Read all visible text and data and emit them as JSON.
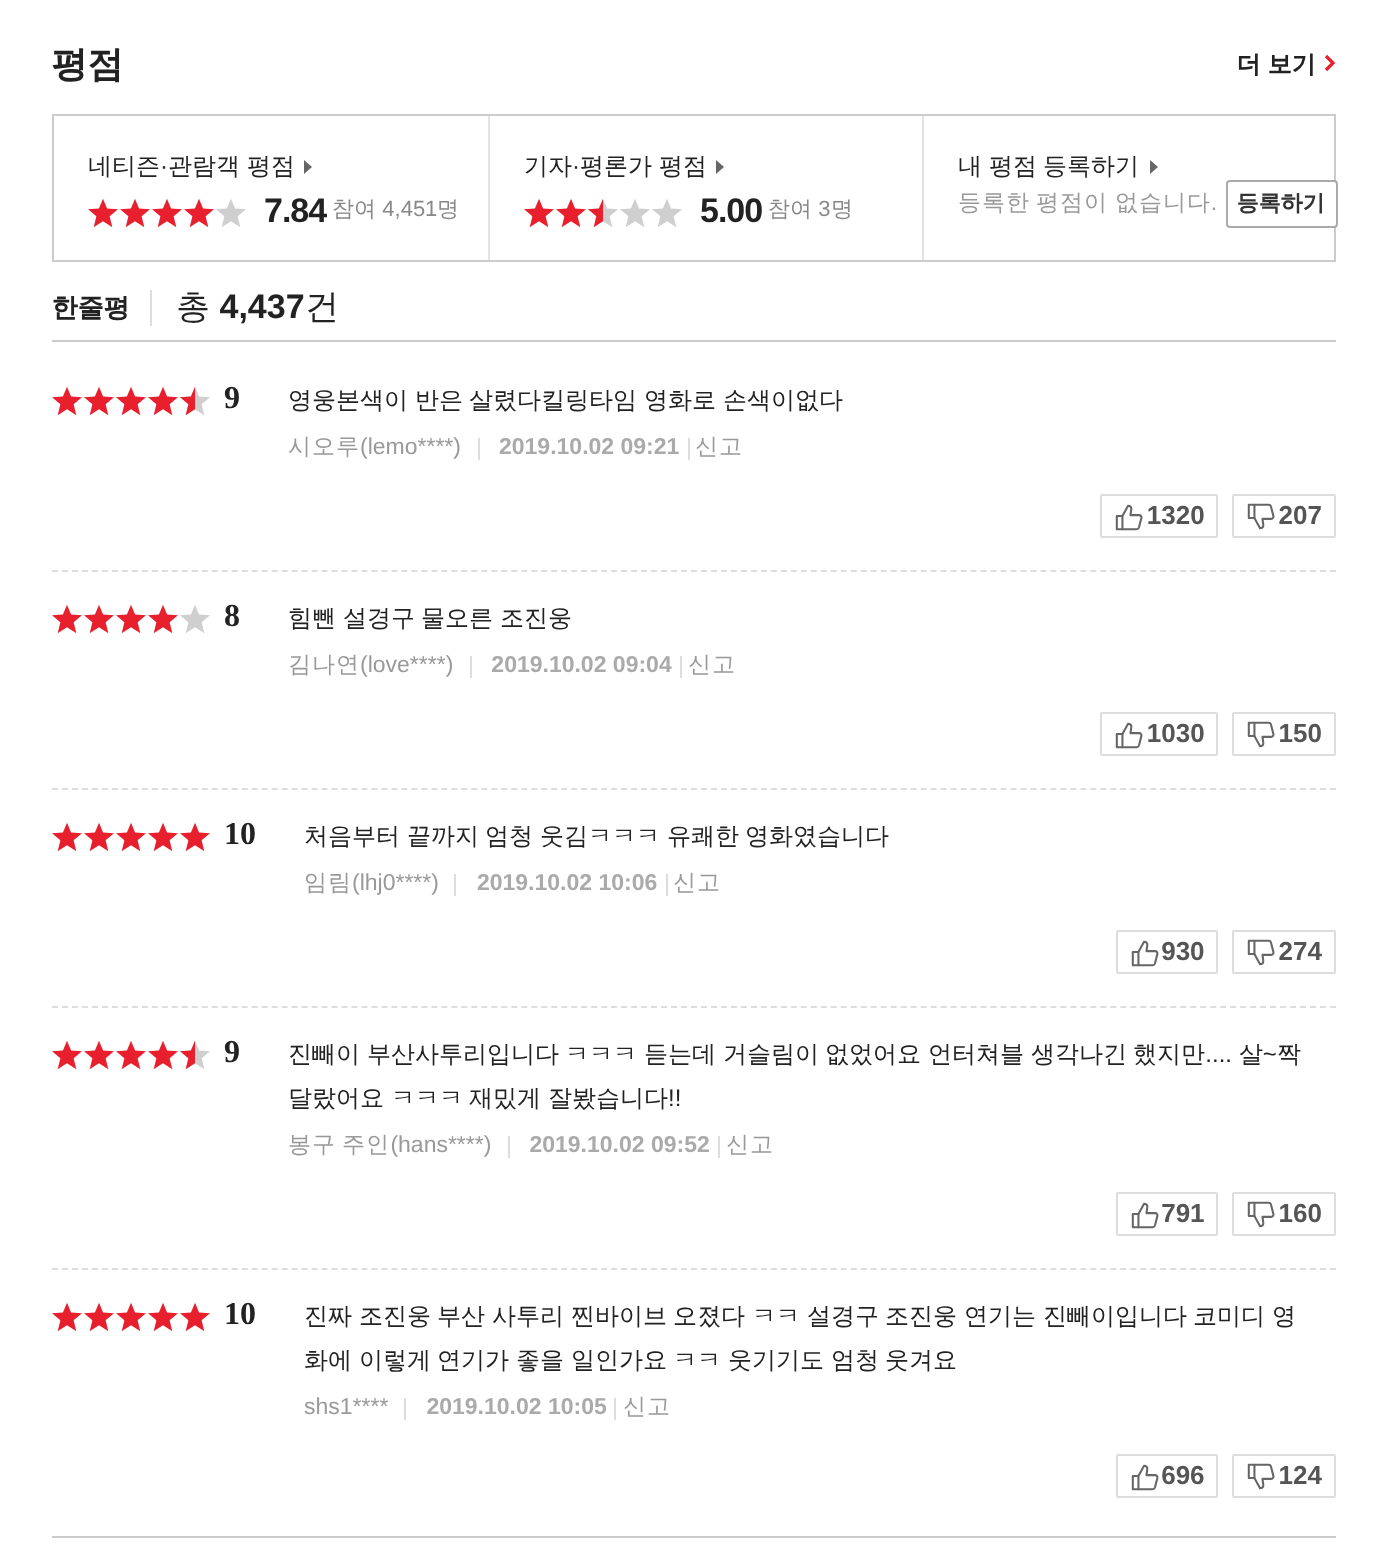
{
  "header": {
    "title": "평점",
    "more_link": "더 보기"
  },
  "summary": [
    {
      "kind": "rating",
      "label": "네티즌·관람객 평점",
      "stars": 4,
      "score": "7.84",
      "participants": "참여 4,451명"
    },
    {
      "kind": "rating",
      "label": "기자·평론가 평점",
      "stars": 2.5,
      "score": "5.00",
      "participants": "참여 3명"
    },
    {
      "kind": "register",
      "label": "내 평점 등록하기",
      "message": "등록한 평점이 없습니다.",
      "button": "등록하기"
    }
  ],
  "comments_header": {
    "title": "한줄평",
    "total": "총 **4,437**건"
  },
  "reviews": [
    {
      "stars": 4.5,
      "score": "9",
      "text": "영웅본색이 반은 살렸다킬링타임 영화로 손색이없다",
      "author": "시오루(lemo****)",
      "date": "2019.10.02 09:21",
      "report": "신고",
      "likes": "1320",
      "dislikes": "207"
    },
    {
      "stars": 4,
      "score": "8",
      "text": "힘뺀 설경구 물오른 조진웅",
      "author": "김나연(love****)",
      "date": "2019.10.02 09:04",
      "report": "신고",
      "likes": "1030",
      "dislikes": "150"
    },
    {
      "stars": 5,
      "score": "10",
      "text": "처음부터 끝까지 엄청 웃김ㅋㅋㅋ 유쾌한 영화였습니다",
      "author": "임림(lhj0****)",
      "date": "2019.10.02 10:06",
      "report": "신고",
      "likes": "930",
      "dislikes": "274"
    },
    {
      "stars": 4.5,
      "score": "9",
      "text": "진빼이 부산사투리입니다 ㅋㅋㅋ 듣는데 거슬림이 없었어요 언터쳐블 생각나긴 했지만.... 살~짝 달랐어요 ㅋㅋㅋ 재밌게 잘봤습니다!!",
      "author": "봉구 주인(hans****)",
      "date": "2019.10.02 09:52",
      "report": "신고",
      "likes": "791",
      "dislikes": "160"
    },
    {
      "stars": 5,
      "score": "10",
      "text": "진짜 조진웅 부산 사투리 찐바이브 오졌다 ㅋㅋ 설경구 조진웅 연기는 진빼이입니다 코미디 영화에 이렇게 연기가 좋을 일인가요 ㅋㅋ 웃기기도 엄청 웃겨요",
      "author": "shs1****",
      "date": "2019.10.02 10:05",
      "report": "신고",
      "likes": "696",
      "dislikes": "124"
    }
  ]
}
